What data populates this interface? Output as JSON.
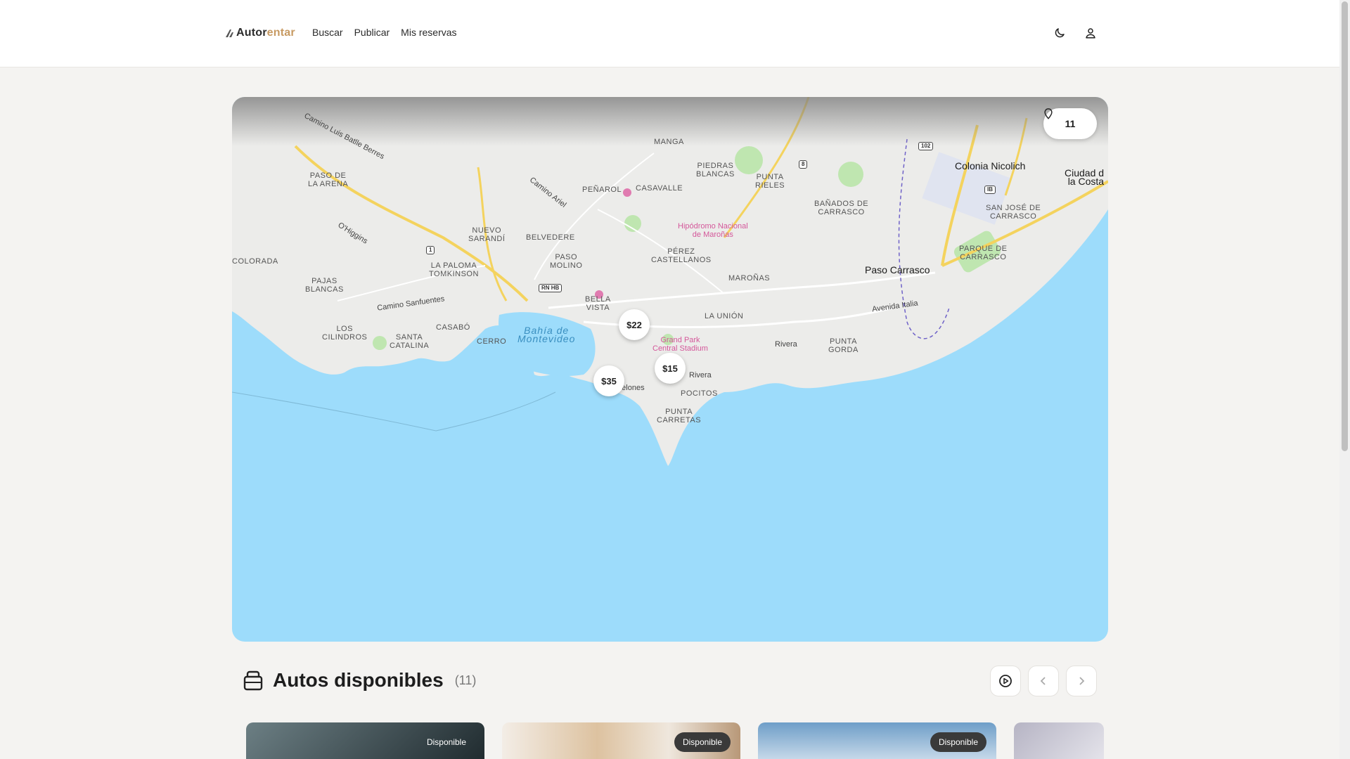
{
  "header": {
    "logo_main": "Autor",
    "logo_accent": "entar",
    "nav": [
      "Buscar",
      "Publicar",
      "Mis reservas"
    ],
    "icons": [
      "moon-icon",
      "user-icon"
    ]
  },
  "map": {
    "count": "11",
    "pins": [
      "$22",
      "$15",
      "$35"
    ],
    "labels": {
      "paso_arena": "PASO DE\nLA ARENA",
      "pajas": "PAJAS\nBLANCAS",
      "los_cilindros": "LOS\nCILINDROS",
      "santa_catalina": "SANTA\nCATALINA",
      "casabo": "CASABÓ",
      "cerro": "CERRO",
      "la_paloma": "LA PALOMA\nTOMKINSON",
      "nuevo_sarandi": "NUEVO\nSARANDÍ",
      "belvedere": "BELVEDERE",
      "paso_molino": "PASO\nMOLINO",
      "penarol": "PEÑAROL",
      "casavalle": "CASAVALLE",
      "piedras_blancas": "PIEDRAS\nBLANCAS",
      "punta_rieles": "PUNTA\nRIELES",
      "banados": "BAÑADOS DE\nCARRASCO",
      "perez": "PÉREZ\nCASTELLANOS",
      "maronas": "MAROÑAS",
      "bella_vista": "BELLA\nVISTA",
      "la_union": "LA UNIÓN",
      "pocitos": "POCITOS",
      "punta_carretas": "PUNTA\nCARRETAS",
      "punta_gorda": "PUNTA\nGORDA",
      "parque_carrasco": "PARQUE DE\nCARRASCO",
      "san_jose": "SAN JOSÉ DE\nCARRASCO",
      "colonia_nicolich": "Colonia Nicolich",
      "ciudad_costa": "Ciudad d\nla Costa",
      "paso_carrasco": "Paso Carrasco",
      "bahia": "Bahía de\nMontevideo",
      "hipodromo": "Hipódromo Nacional\nde Maroñas",
      "grand_park": "Grand Park\nCentral Stadium",
      "manga": "MANGA",
      "colorada": "COLORADA",
      "road_batlle": "Camino Luis Batlle Berres",
      "road_ariel": "Camino Ariel",
      "road_ohiggins": "O'Higgins",
      "road_sanfuentes": "Camino Sanfuentes",
      "road_italia": "Avenida Italia",
      "road_rivera": "Rivera",
      "road_rivera2": "Rivera",
      "road_canelones": "Canelones"
    },
    "shields": [
      "1",
      "RN HB",
      "8",
      "102",
      "IB"
    ]
  },
  "section": {
    "title": "Autos disponibles",
    "count": "(11)"
  },
  "cards": [
    {
      "badge": "Disponible"
    },
    {
      "badge": "Disponible"
    },
    {
      "badge": "Disponible"
    },
    {
      "badge": ""
    }
  ],
  "colors": {
    "accent": "#c79a62",
    "water": "#9ddcfb",
    "land": "#ececea",
    "park": "#bfe6b0",
    "road_major": "#f4d35e"
  }
}
